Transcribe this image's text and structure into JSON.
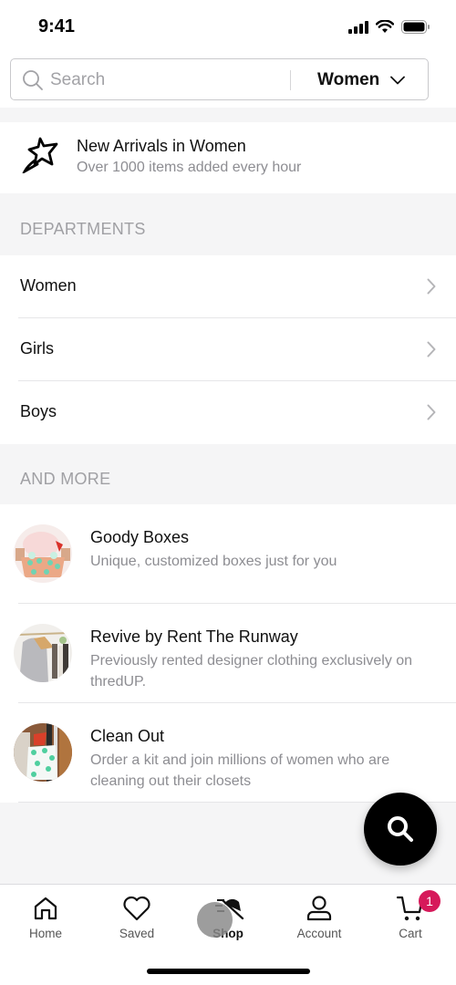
{
  "status_bar": {
    "time": "9:41",
    "icons": [
      "cellular-signal-icon",
      "wifi-icon",
      "battery-icon"
    ]
  },
  "search": {
    "placeholder": "Search",
    "department_selected": "Women",
    "icon": "search-icon"
  },
  "new_arrivals": {
    "icon": "shooting-star-icon",
    "title": "New Arrivals in Women",
    "subtitle": "Over 1000 items added every hour"
  },
  "departments": {
    "header": "DEPARTMENTS",
    "items": [
      {
        "label": "Women"
      },
      {
        "label": "Girls"
      },
      {
        "label": "Boys"
      }
    ]
  },
  "and_more": {
    "header": "AND MORE",
    "items": [
      {
        "title": "Goody Boxes",
        "subtitle": "Unique, customized boxes just for you",
        "thumb": "goody-box-photo"
      },
      {
        "title": "Revive by Rent The Runway",
        "subtitle": "Previously rented designer clothing exclusively on thredUP.",
        "thumb": "clothing-rack-photo"
      },
      {
        "title": "Clean Out",
        "subtitle": "Order a kit and join millions of women who are cleaning out their closets",
        "thumb": "clean-out-bag-photo"
      }
    ]
  },
  "fab": {
    "icon": "search-icon"
  },
  "tab_bar": {
    "active": "Shop",
    "tabs": [
      {
        "label": "Home",
        "icon": "home-icon"
      },
      {
        "label": "Saved",
        "icon": "heart-icon"
      },
      {
        "label": "Shop",
        "icon": "shop-hat-icon"
      },
      {
        "label": "Account",
        "icon": "person-icon"
      },
      {
        "label": "Cart",
        "icon": "cart-icon",
        "badge": "1"
      }
    ]
  },
  "colors": {
    "badge": "#d6195a",
    "background": "#f5f5f6",
    "muted_text": "#8d8d92"
  }
}
